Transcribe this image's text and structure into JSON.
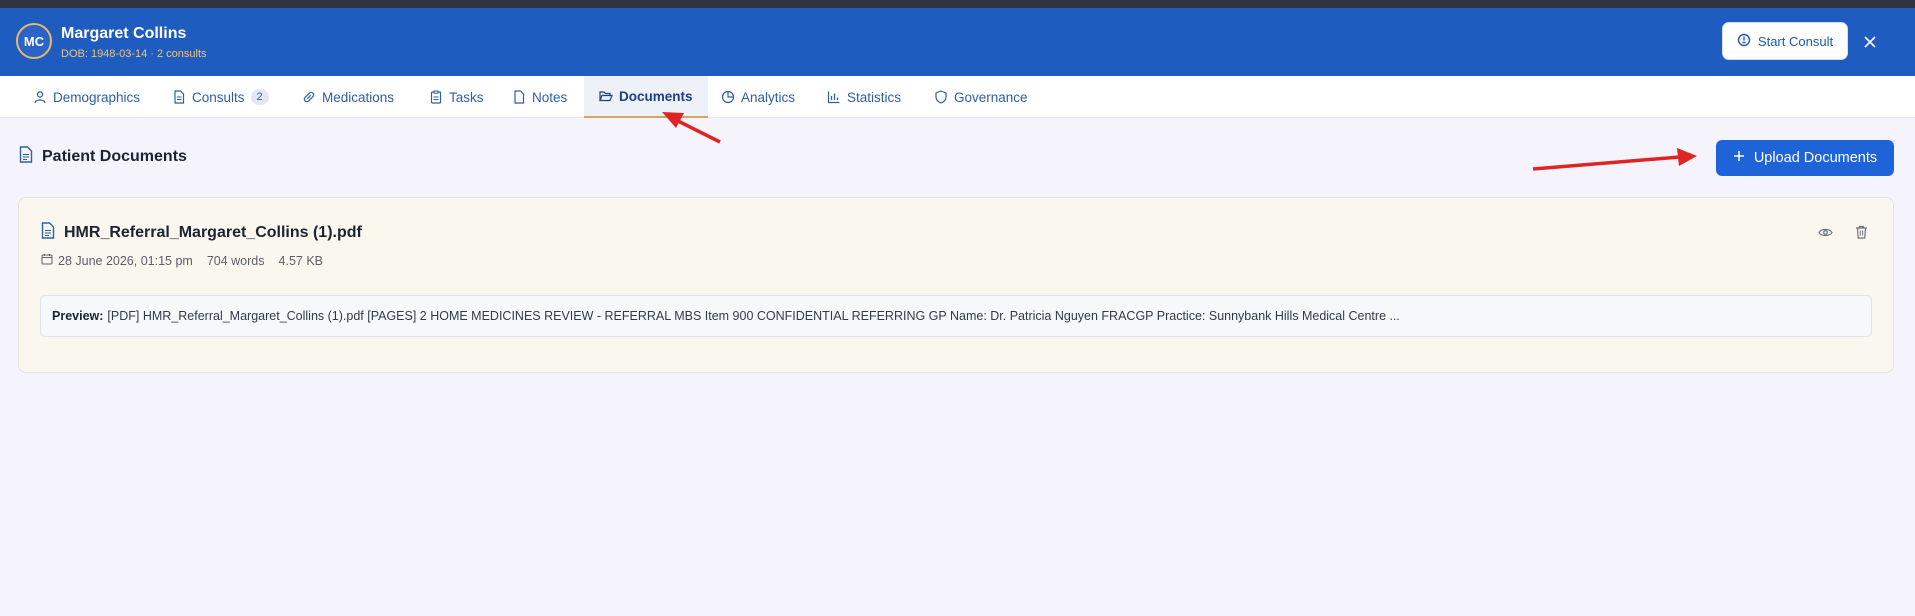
{
  "patient": {
    "initials": "MC",
    "name": "Margaret Collins",
    "meta": "DOB: 1948-03-14 · 2 consults"
  },
  "header": {
    "start_consult_label": "Start Consult",
    "close_icon": "close-icon"
  },
  "tabs": [
    {
      "label": "Demographics",
      "icon": "user-icon"
    },
    {
      "label": "Consults",
      "icon": "file-icon",
      "badge": "2"
    },
    {
      "label": "Medications",
      "icon": "pill-icon"
    },
    {
      "label": "Tasks",
      "icon": "clipboard-icon"
    },
    {
      "label": "Notes",
      "icon": "note-icon"
    },
    {
      "label": "Documents",
      "icon": "folder-open-icon",
      "active": true
    },
    {
      "label": "Analytics",
      "icon": "pie-chart-icon"
    },
    {
      "label": "Statistics",
      "icon": "bar-chart-icon"
    },
    {
      "label": "Governance",
      "icon": "shield-icon"
    }
  ],
  "section": {
    "title": "Patient Documents",
    "upload_label": "Upload Documents"
  },
  "documents": [
    {
      "name": "HMR_Referral_Margaret_Collins (1).pdf",
      "date": "28 June 2026, 01:15 pm",
      "words": "704 words",
      "size": "4.57 KB",
      "preview_label": "Preview:",
      "preview_text": "[PDF] HMR_Referral_Margaret_Collins (1).pdf [PAGES] 2 HOME MEDICINES REVIEW - REFERRAL MBS Item 900 CONFIDENTIAL REFERRING GP Name: Dr. Patricia Nguyen FRACGP Practice: Sunnybank Hills Medical Centre ..."
    }
  ],
  "colors": {
    "header_bg": "#1f5cc0",
    "accent": "#1e63d8",
    "annotation_arrow": "#e02424",
    "active_tab_underline": "#d4a461"
  }
}
